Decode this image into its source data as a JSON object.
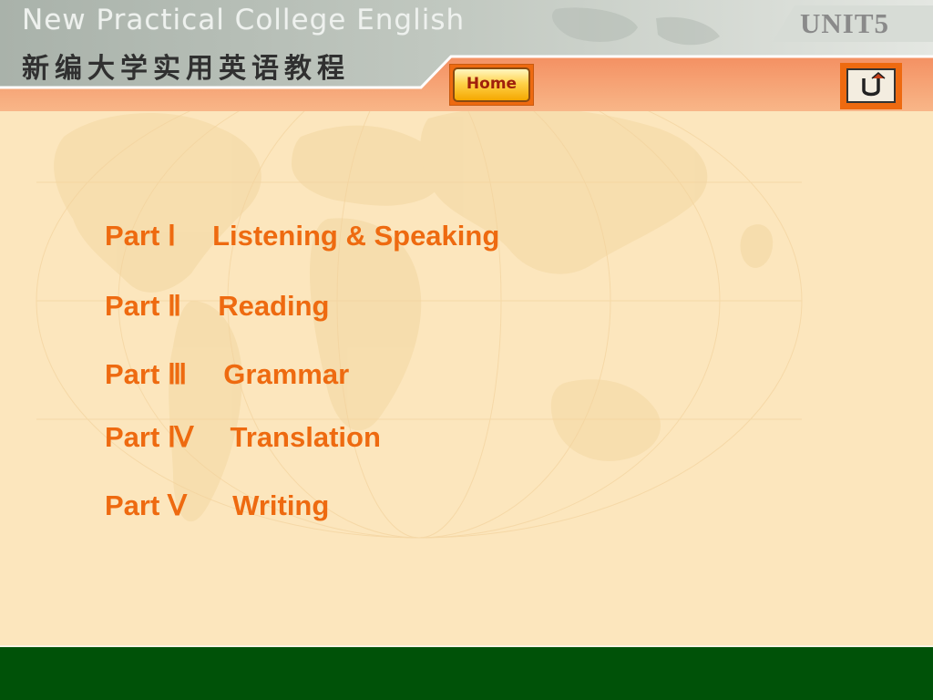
{
  "header": {
    "title_en": "New Practical College English",
    "title_cn": "新编大学实用英语教程",
    "unit": "UNIT5",
    "home_label": "Home",
    "return_icon": "return-arrow-icon"
  },
  "menu": {
    "items": [
      {
        "part": "Part Ⅰ",
        "name": "Listening & Speaking"
      },
      {
        "part": "Part Ⅱ",
        "name": "Reading"
      },
      {
        "part": "Part Ⅲ",
        "name": "Grammar"
      },
      {
        "part": "Part Ⅳ",
        "name": "Translation"
      },
      {
        "part": "Part Ⅴ",
        "name": "Writing"
      }
    ]
  },
  "colors": {
    "background": "#fce6bd",
    "link": "#ee6a10",
    "footer": "#005208",
    "header_band": "#f6a070"
  }
}
